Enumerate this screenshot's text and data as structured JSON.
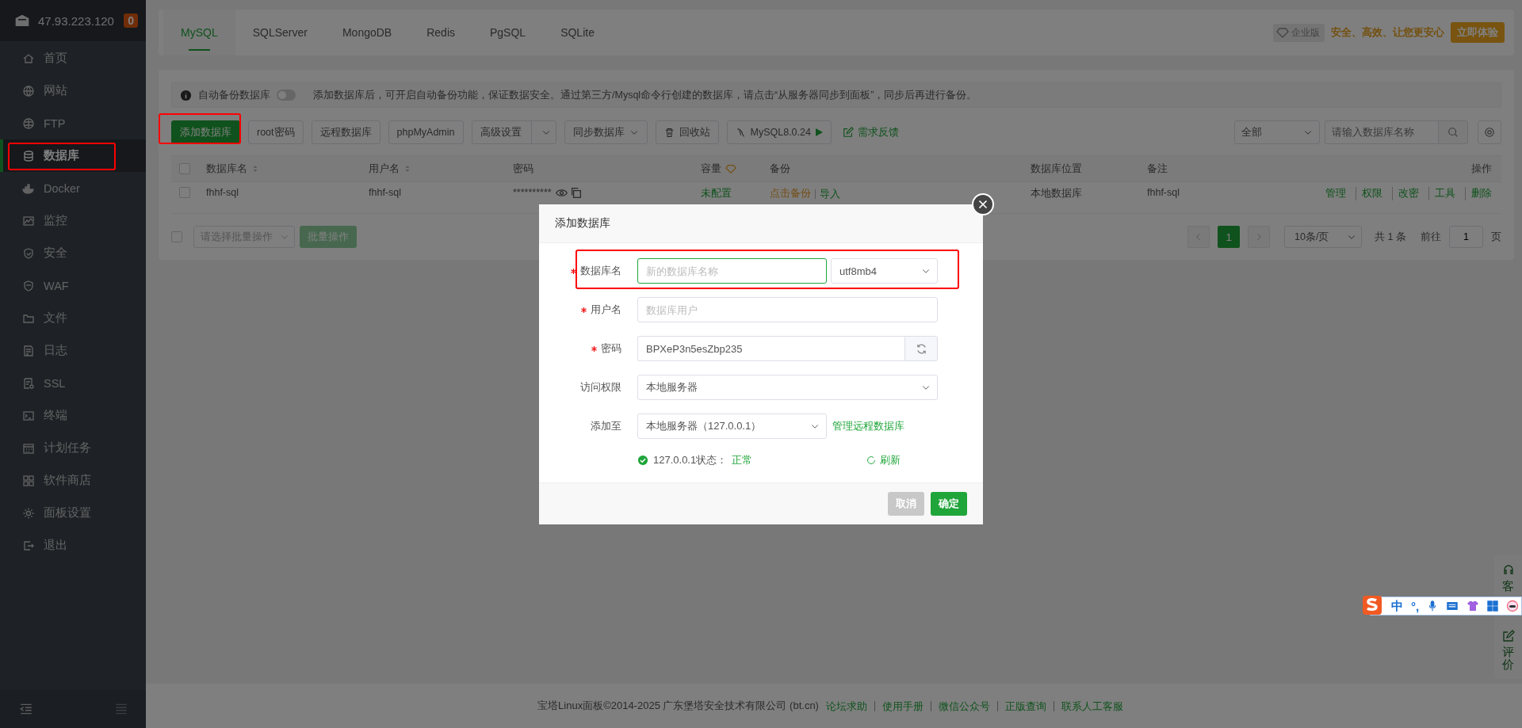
{
  "sidebar": {
    "server": "47.93.223.120",
    "badge": "0",
    "items": [
      {
        "label": "首页",
        "selected": false,
        "annotated": false
      },
      {
        "label": "网站",
        "selected": false,
        "annotated": false
      },
      {
        "label": "FTP",
        "selected": false,
        "annotated": false
      },
      {
        "label": "数据库",
        "selected": true,
        "annotated": true
      },
      {
        "label": "Docker",
        "selected": false,
        "annotated": false
      },
      {
        "label": "监控",
        "selected": false,
        "annotated": false
      },
      {
        "label": "安全",
        "selected": false,
        "annotated": false
      },
      {
        "label": "WAF",
        "selected": false,
        "annotated": false
      },
      {
        "label": "文件",
        "selected": false,
        "annotated": false
      },
      {
        "label": "日志",
        "selected": false,
        "annotated": false
      },
      {
        "label": "SSL",
        "selected": false,
        "annotated": false
      },
      {
        "label": "终端",
        "selected": false,
        "annotated": false
      },
      {
        "label": "计划任务",
        "selected": false,
        "annotated": false
      },
      {
        "label": "软件商店",
        "selected": false,
        "annotated": false
      },
      {
        "label": "面板设置",
        "selected": false,
        "annotated": false
      },
      {
        "label": "退出",
        "selected": false,
        "annotated": false
      }
    ]
  },
  "tabs": [
    {
      "label": "MySQL",
      "selected": true
    },
    {
      "label": "SQLServer",
      "selected": false
    },
    {
      "label": "MongoDB",
      "selected": false
    },
    {
      "label": "Redis",
      "selected": false
    },
    {
      "label": "PgSQL",
      "selected": false
    },
    {
      "label": "SQLite",
      "selected": false
    }
  ],
  "promo": {
    "badge": "企业版",
    "slogan": "安全、高效、让您更安心",
    "button": "立即体验"
  },
  "notice": {
    "toggle_label": "自动备份数据库",
    "on": false,
    "text": "添加数据库后，可开启自动备份功能，保证数据安全。通过第三方/Mysql命令行创建的数据库，请点击“从服务器同步到面板”，同步后再进行备份。"
  },
  "toolbar": {
    "buttons": [
      {
        "label": "添加数据库",
        "kind": "primary",
        "annotated": true
      },
      {
        "label": "root密码",
        "kind": "plain",
        "annotated": false
      },
      {
        "label": "远程数据库",
        "kind": "plain",
        "annotated": false
      },
      {
        "label": "phpMyAdmin",
        "kind": "plain",
        "annotated": false
      },
      {
        "label": "高级设置",
        "kind": "split",
        "annotated": false
      },
      {
        "label": "同步数据库",
        "kind": "dropdown",
        "annotated": false
      },
      {
        "label": "回收站",
        "kind": "trash",
        "annotated": false
      },
      {
        "label": "MySQL8.0.24",
        "kind": "version",
        "annotated": false
      }
    ],
    "feedback": "需求反馈",
    "filter": "全部",
    "search_placeholder": "请输入数据库名称"
  },
  "table": {
    "all_checked": false,
    "columns": [
      {
        "label": "数据库名",
        "kind": "sort"
      },
      {
        "label": "用户名",
        "kind": "sort"
      },
      {
        "label": "密码",
        "kind": "plain"
      },
      {
        "label": "容量",
        "kind": "premium"
      },
      {
        "label": "备份",
        "kind": "plain"
      },
      {
        "label": "数据库位置",
        "kind": "plain"
      },
      {
        "label": "备注",
        "kind": "plain"
      },
      {
        "label": "操作",
        "kind": "right"
      }
    ],
    "rows": [
      {
        "checked": false,
        "name": "fhhf-sql",
        "user": "fhhf-sql",
        "password": "**********",
        "capacity": "未配置",
        "backup": "点击备份",
        "import": "导入",
        "location": "本地数据库",
        "note": "fhhf-sql",
        "actions": [
          "管理",
          "权限",
          "改密",
          "工具",
          "删除"
        ]
      }
    ]
  },
  "pager": {
    "checked": false,
    "batch_placeholder": "请选择批量操作",
    "batch_button": "批量操作",
    "pages": [
      {
        "label": "1",
        "selected": true
      }
    ],
    "page_size": "10条/页",
    "total": "共 1 条",
    "goto": "前往",
    "goto_value": "1",
    "page_unit": "页"
  },
  "dialog": {
    "title": "添加数据库",
    "fields": [
      {
        "label": "数据库名",
        "required": true,
        "kind": "text_select",
        "placeholder": "新的数据库名称",
        "focused": true,
        "select": "utf8mb4",
        "annotated": true
      },
      {
        "label": "用户名",
        "required": true,
        "kind": "text",
        "placeholder": "数据库用户",
        "focused": false,
        "annotated": false
      },
      {
        "label": "密码",
        "required": true,
        "kind": "text_button",
        "value": "BPXeP3n5esZbp235",
        "focused": false,
        "annotated": false
      },
      {
        "label": "访问权限",
        "required": false,
        "kind": "select",
        "value": "本地服务器",
        "annotated": false
      },
      {
        "label": "添加至",
        "required": false,
        "kind": "select_link",
        "value": "本地服务器（127.0.0.1）",
        "link": "管理远程数据库",
        "annotated": false
      }
    ],
    "status": {
      "ok": true,
      "label": "127.0.0.1状态：",
      "value": "正常",
      "refresh": "刷新"
    },
    "buttons": [
      {
        "label": "取消",
        "kind": "secondary"
      },
      {
        "label": "确定",
        "kind": "primary"
      }
    ]
  },
  "footer": {
    "copyright": "宝塔Linux面板©2014-2025 广东堡塔安全技术有限公司 (bt.cn)",
    "links": [
      "论坛求助",
      "使用手册",
      "微信公众号",
      "正版查询",
      "联系人工客服"
    ]
  },
  "side_panel": {
    "items": [
      "客",
      "评价"
    ]
  },
  "ime": {
    "mode": "中",
    "punct": "°,"
  }
}
